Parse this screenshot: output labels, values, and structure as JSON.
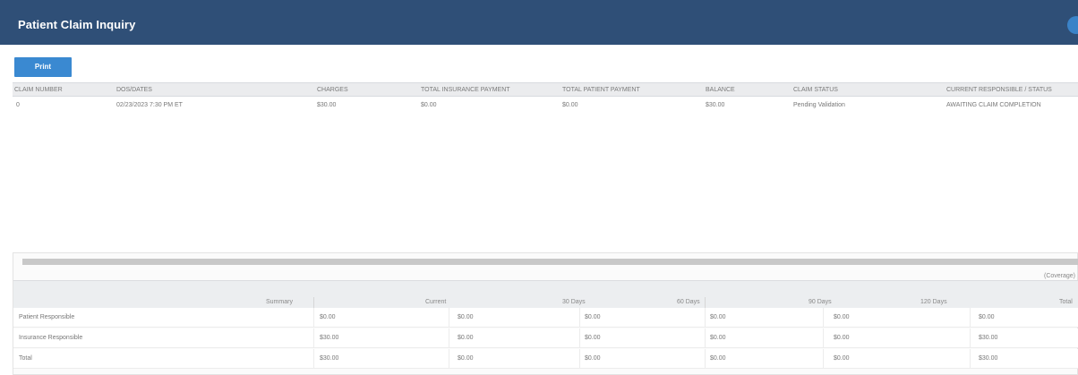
{
  "header": {
    "title": "Patient Claim Inquiry"
  },
  "toolbar": {
    "print_label": "Print"
  },
  "claims_table": {
    "columns": [
      "CLAIM NUMBER",
      "DOS/DATES",
      "CHARGES",
      "TOTAL INSURANCE PAYMENT",
      "TOTAL PATIENT PAYMENT",
      "BALANCE",
      "CLAIM STATUS",
      "CURRENT RESPONSIBLE / STATUS"
    ],
    "rows": [
      [
        "0",
        "02/23/2023 7:30 PM ET",
        "$30.00",
        "$0.00",
        "$0.00",
        "$30.00",
        "Pending Validation",
        "AWAITING CLAIM COMPLETION"
      ]
    ]
  },
  "coverage_label": "(Coverage)",
  "summary_table": {
    "columns": [
      "Summary",
      "Current",
      "30 Days",
      "60 Days",
      "90 Days",
      "120 Days",
      "Total"
    ],
    "rows": [
      {
        "label": "Patient Responsible",
        "values": [
          "$0.00",
          "$0.00",
          "$0.00",
          "$0.00",
          "$0.00",
          "$0.00"
        ]
      },
      {
        "label": "Insurance Responsible",
        "values": [
          "$30.00",
          "$0.00",
          "$0.00",
          "$0.00",
          "$0.00",
          "$30.00"
        ]
      },
      {
        "label": "Total",
        "values": [
          "$30.00",
          "$0.00",
          "$0.00",
          "$0.00",
          "$0.00",
          "$30.00"
        ]
      }
    ]
  }
}
